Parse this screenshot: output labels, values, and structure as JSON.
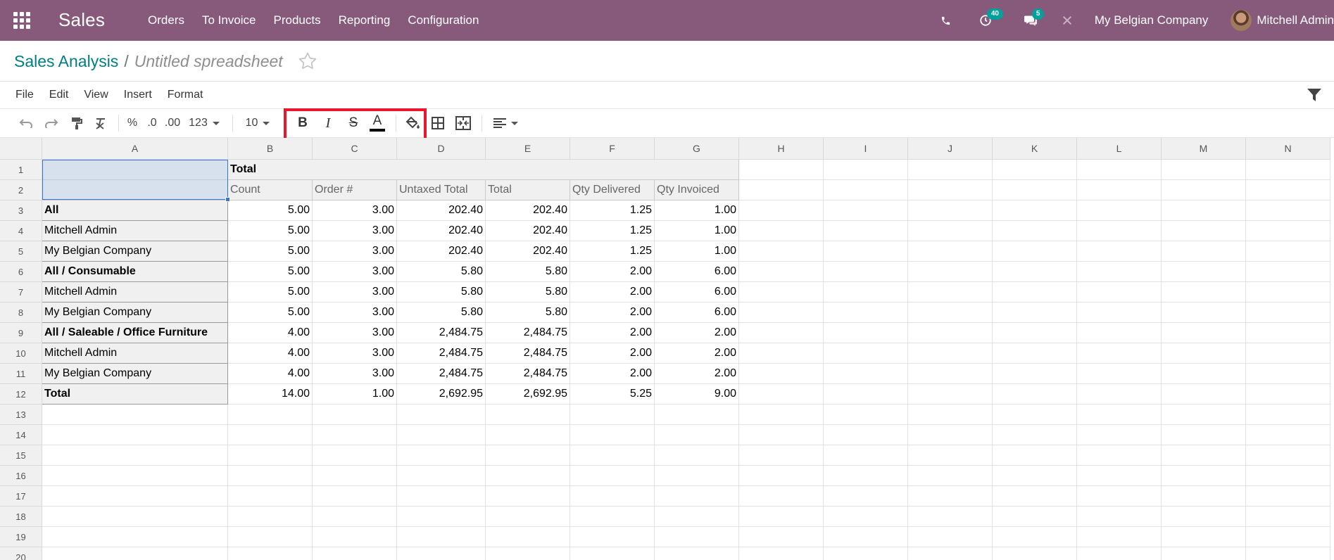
{
  "navbar": {
    "app_name": "Sales",
    "menu": [
      "Orders",
      "To Invoice",
      "Products",
      "Reporting",
      "Configuration"
    ],
    "activity_count": "40",
    "message_count": "5",
    "company": "My Belgian Company",
    "user": "Mitchell Admin",
    "color": "#875a7b"
  },
  "breadcrumb": {
    "parent": "Sales Analysis",
    "separator": "/",
    "current": "Untitled spreadsheet"
  },
  "menubar": [
    "File",
    "Edit",
    "View",
    "Insert",
    "Format"
  ],
  "toolbar": {
    "percent": "%",
    "decrease_decimal": ".0",
    "increase_decimal": ".00",
    "number_format": "123",
    "font_size": "10",
    "bold": "B",
    "italic": "I",
    "strike": "S",
    "text_color": "A",
    "highlight_color": "#e8172b"
  },
  "sheet": {
    "columns": [
      "A",
      "B",
      "C",
      "D",
      "E",
      "F",
      "G",
      "H",
      "I",
      "J",
      "K",
      "L",
      "M",
      "N"
    ],
    "rows": [
      "1",
      "2",
      "3",
      "4",
      "5",
      "6",
      "7",
      "8",
      "9",
      "10",
      "11",
      "12",
      "13",
      "14",
      "15",
      "16",
      "17",
      "18",
      "19",
      "20"
    ],
    "total_header": "Total",
    "measure_headers": [
      "Count",
      "Order #",
      "Untaxed Total",
      "Total",
      "Qty Delivered",
      "Qty Invoiced"
    ],
    "data_rows": [
      {
        "label": "All",
        "bold": true,
        "values": [
          "5.00",
          "3.00",
          "202.40",
          "202.40",
          "1.25",
          "1.00"
        ]
      },
      {
        "label": "Mitchell Admin",
        "bold": false,
        "values": [
          "5.00",
          "3.00",
          "202.40",
          "202.40",
          "1.25",
          "1.00"
        ]
      },
      {
        "label": "My Belgian Company",
        "bold": false,
        "values": [
          "5.00",
          "3.00",
          "202.40",
          "202.40",
          "1.25",
          "1.00"
        ]
      },
      {
        "label": "All / Consumable",
        "bold": true,
        "values": [
          "5.00",
          "3.00",
          "5.80",
          "5.80",
          "2.00",
          "6.00"
        ]
      },
      {
        "label": "Mitchell Admin",
        "bold": false,
        "values": [
          "5.00",
          "3.00",
          "5.80",
          "5.80",
          "2.00",
          "6.00"
        ]
      },
      {
        "label": "My Belgian Company",
        "bold": false,
        "values": [
          "5.00",
          "3.00",
          "5.80",
          "5.80",
          "2.00",
          "6.00"
        ]
      },
      {
        "label": "All / Saleable / Office Furniture",
        "bold": true,
        "values": [
          "4.00",
          "3.00",
          "2,484.75",
          "2,484.75",
          "2.00",
          "2.00"
        ]
      },
      {
        "label": "Mitchell Admin",
        "bold": false,
        "values": [
          "4.00",
          "3.00",
          "2,484.75",
          "2,484.75",
          "2.00",
          "2.00"
        ]
      },
      {
        "label": "My Belgian Company",
        "bold": false,
        "values": [
          "4.00",
          "3.00",
          "2,484.75",
          "2,484.75",
          "2.00",
          "2.00"
        ]
      },
      {
        "label": "Total",
        "bold": true,
        "values": [
          "14.00",
          "1.00",
          "2,692.95",
          "2,692.95",
          "5.25",
          "9.00"
        ]
      }
    ]
  }
}
